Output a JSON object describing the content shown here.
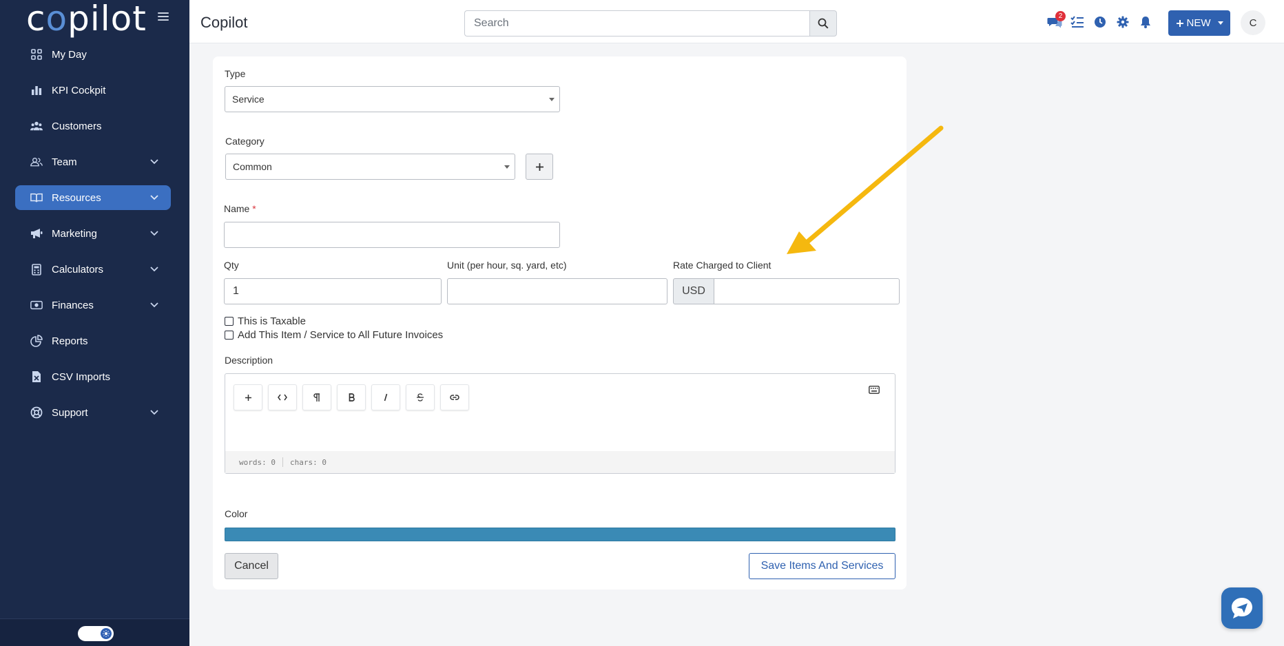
{
  "sidebar": {
    "logo_pre": "c",
    "logo_o": "o",
    "logo_post": "pilot",
    "items": [
      {
        "label": "My Day",
        "icon": "grid-icon",
        "active": false,
        "expandable": false
      },
      {
        "label": "KPI Cockpit",
        "icon": "bar-chart-icon",
        "active": false,
        "expandable": false
      },
      {
        "label": "Customers",
        "icon": "users-icon",
        "active": false,
        "expandable": false
      },
      {
        "label": "Team",
        "icon": "user-group-icon",
        "active": false,
        "expandable": true
      },
      {
        "label": "Resources",
        "icon": "book-icon",
        "active": true,
        "expandable": true
      },
      {
        "label": "Marketing",
        "icon": "megaphone-icon",
        "active": false,
        "expandable": true
      },
      {
        "label": "Calculators",
        "icon": "calculator-icon",
        "active": false,
        "expandable": true
      },
      {
        "label": "Finances",
        "icon": "money-icon",
        "active": false,
        "expandable": true
      },
      {
        "label": "Reports",
        "icon": "pie-chart-icon",
        "active": false,
        "expandable": false
      },
      {
        "label": "CSV Imports",
        "icon": "csv-file-icon",
        "active": false,
        "expandable": false
      },
      {
        "label": "Support",
        "icon": "lifebuoy-icon",
        "active": false,
        "expandable": true
      }
    ],
    "theme_toggle": "on"
  },
  "header": {
    "title": "Copilot",
    "search_placeholder": "Search",
    "messages_badge": "2",
    "new_button": "NEW",
    "avatar_initial": "C"
  },
  "form": {
    "type_label": "Type",
    "type_value": "Service",
    "category_label": "Category",
    "category_value": "Common",
    "name_label": "Name",
    "name_required": "*",
    "name_value": "",
    "qty_label": "Qty",
    "qty_value": "1",
    "unit_label": "Unit (per hour, sq. yard, etc)",
    "unit_value": "",
    "rate_label": "Rate Charged to Client",
    "rate_currency": "USD",
    "rate_value": "",
    "taxable_label": "This is Taxable",
    "future_invoices_label": "Add This Item / Service to All Future Invoices",
    "description_label": "Description",
    "editor_words": "words: 0",
    "editor_chars": "chars: 0",
    "color_label": "Color",
    "color_value": "#3a8ab5",
    "cancel_label": "Cancel",
    "save_label": "Save Items And Services"
  },
  "colors": {
    "sidebar_bg": "#1b2a4a",
    "accent": "#2f61b0",
    "active_nav": "#3b6fc1",
    "annotation_arrow": "#f5b80f"
  }
}
